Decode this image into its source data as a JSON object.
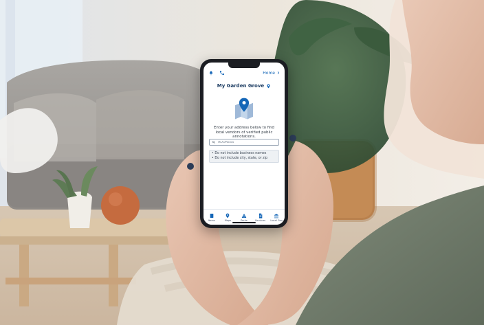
{
  "phone": {
    "top": {
      "back_label": "Home"
    },
    "title": "My Garden Grove",
    "description": "Enter your address below to find local vendors of verified public annotations.",
    "search": {
      "value": "ADDRESS",
      "placeholder": "ADDRESS"
    },
    "tips": [
      "• Do not include business names",
      "• Do not include city, state, or zip"
    ],
    "nav": [
      {
        "label": "Items",
        "icon": "list-icon"
      },
      {
        "label": "Maps",
        "icon": "location-pin-icon"
      },
      {
        "label": "Parks",
        "icon": "triangle-icon"
      },
      {
        "label": "Services",
        "icon": "document-icon"
      },
      {
        "label": "Local Gov",
        "icon": "bank-icon"
      }
    ]
  },
  "colors": {
    "brand_blue": "#1466b7",
    "title_navy": "#1b3b61",
    "screen_bg": "#ffffff",
    "phone_body": "#1b1d22"
  }
}
